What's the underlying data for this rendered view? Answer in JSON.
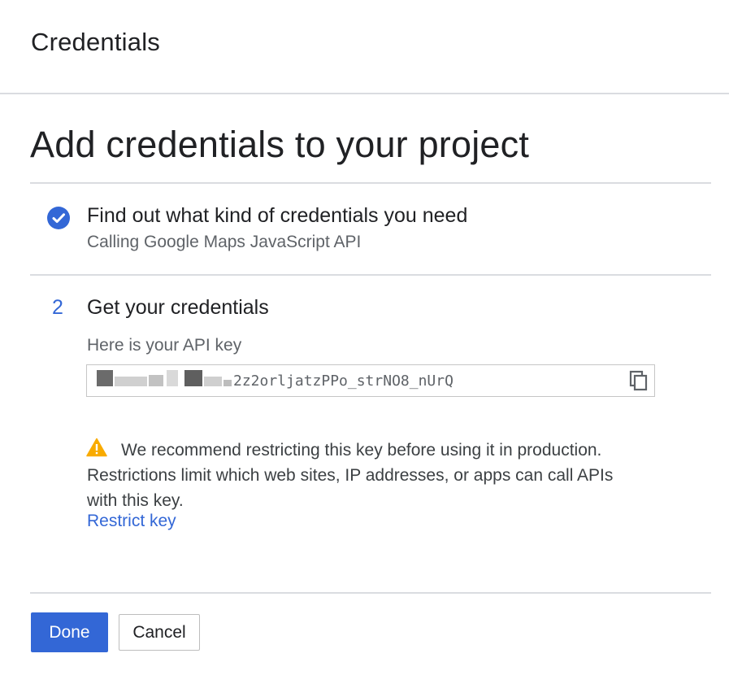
{
  "header": {
    "title": "Credentials"
  },
  "page": {
    "title": "Add credentials to your project"
  },
  "steps": [
    {
      "marker": "check",
      "title": "Find out what kind of credentials you need",
      "subtitle": "Calling Google Maps JavaScript API"
    },
    {
      "number": "2",
      "title": "Get your credentials",
      "key_label": "Here is your API key",
      "api_key_visible": "2z2orljatzPPo_strNO8_nUrQ"
    }
  ],
  "warning": {
    "icon": "warning-icon",
    "text": "We recommend restricting this key before using it in production. Restrictions limit which web sites, IP addresses, or apps can call APIs with this key.",
    "link_label": "Restrict key"
  },
  "actions": {
    "done_label": "Done",
    "cancel_label": "Cancel"
  },
  "colors": {
    "accent": "#3367d6",
    "warning": "#f9ab00",
    "divider": "#dadce0"
  }
}
